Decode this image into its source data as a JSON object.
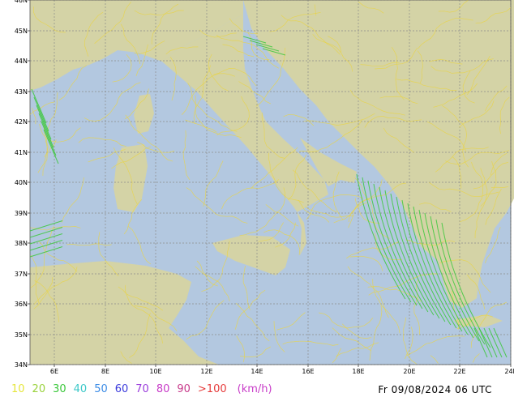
{
  "map": {
    "colors": {
      "sea": "#b3c8e0",
      "land": "#d4d3a6",
      "grid": "#8c8c8c",
      "streamline_weak": "#e8d34a",
      "streamline_strong": "#3cc83c"
    },
    "lat_labels": [
      "34N",
      "35N",
      "36N",
      "37N",
      "38N",
      "39N",
      "40N",
      "41N",
      "42N",
      "43N",
      "44N",
      "45N",
      "46N"
    ],
    "lon_labels": [
      "6E",
      "8E",
      "10E",
      "12E",
      "14E",
      "16E",
      "18E",
      "20E",
      "22E",
      "24E"
    ]
  },
  "legend": {
    "items": [
      {
        "label": "10",
        "color": "#e6e63c"
      },
      {
        "label": "20",
        "color": "#9ad23c"
      },
      {
        "label": "30",
        "color": "#3cc83c"
      },
      {
        "label": "40",
        "color": "#3cc8c8"
      },
      {
        "label": "50",
        "color": "#3c8ce6"
      },
      {
        "label": "60",
        "color": "#3c3cdc"
      },
      {
        "label": "70",
        "color": "#9a3cdc"
      },
      {
        "label": "80",
        "color": "#c83cc8"
      },
      {
        "label": "90",
        "color": "#c83c8c"
      },
      {
        "label": ">100",
        "color": "#e63c3c"
      }
    ],
    "unit": "(km/h)",
    "unit_color": "#c83cc8"
  },
  "timestamp": "Fr 09/08/2024 06 UTC"
}
